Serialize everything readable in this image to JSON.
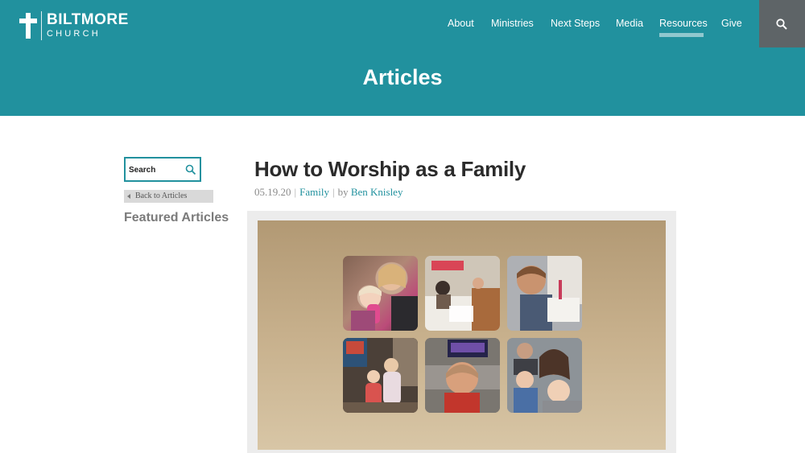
{
  "header": {
    "logo": {
      "name": "BILTMORE",
      "sub": "CHURCH"
    },
    "nav": [
      {
        "label": "About"
      },
      {
        "label": "Ministries"
      },
      {
        "label": "Next Steps"
      },
      {
        "label": "Media"
      },
      {
        "label": "Resources",
        "active": true
      },
      {
        "label": "Give"
      }
    ],
    "search_icon": "search-icon",
    "title": "Articles"
  },
  "sidebar": {
    "search_placeholder": "Search",
    "search_icon": "search-icon",
    "back_label": "Back to Articles",
    "featured_heading": "Featured Articles"
  },
  "article": {
    "title": "How to Worship as a Family",
    "date": "05.19.20",
    "category": "Family",
    "by": "by",
    "author": "Ben Knisley"
  },
  "colors": {
    "brand": "#21919e",
    "search_box": "#5e6467",
    "featured_text": "#7b7b7b"
  }
}
